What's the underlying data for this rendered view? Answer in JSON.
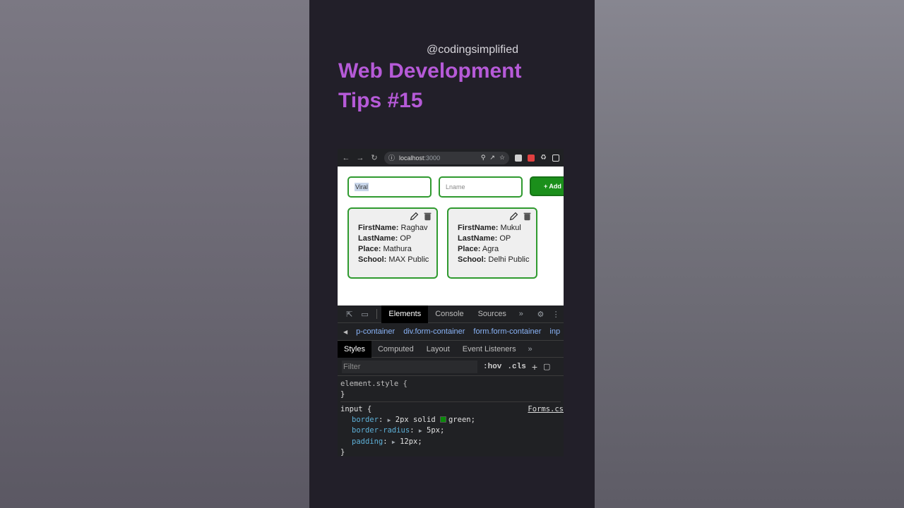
{
  "overlay": {
    "handle": "@codingsimplified",
    "title_line1": "Web Development",
    "title_line2": "Tips #15"
  },
  "browser": {
    "url_host": "localhost",
    "url_port": ":3000"
  },
  "form": {
    "fname_value": "Viral",
    "lname_placeholder": "Lname",
    "add_label": "+ Add"
  },
  "cards": [
    {
      "first_label": "FirstName:",
      "first": "Raghav",
      "last_label": "LastName:",
      "last": "OP",
      "place_label": "Place:",
      "place": "Mathura",
      "school_label": "School:",
      "school": "MAX Public"
    },
    {
      "first_label": "FirstName:",
      "first": "Mukul",
      "last_label": "LastName:",
      "last": "OP",
      "place_label": "Place:",
      "place": "Agra",
      "school_label": "School:",
      "school": "Delhi Public"
    }
  ],
  "devtools": {
    "tabs": [
      "Elements",
      "Console",
      "Sources"
    ],
    "crumbs": [
      "p-container",
      "div.form-container",
      "form.form-container",
      "inp"
    ],
    "sub_tabs": [
      "Styles",
      "Computed",
      "Layout",
      "Event Listeners"
    ],
    "filter_placeholder": "Filter",
    "hov": ":hov",
    "cls": ".cls",
    "rule1_selector": "element.style {",
    "rule1_close": "}",
    "rule2_selector": "input {",
    "rule2_source": "Forms.cs",
    "decls": [
      {
        "prop": "border",
        "value": "2px solid",
        "color_name": "green;",
        "swatch": "#0a8a0a"
      },
      {
        "prop": "border-radius",
        "value": "5px;"
      },
      {
        "prop": "padding",
        "value": "12px;"
      }
    ],
    "rule2_close": "}"
  }
}
